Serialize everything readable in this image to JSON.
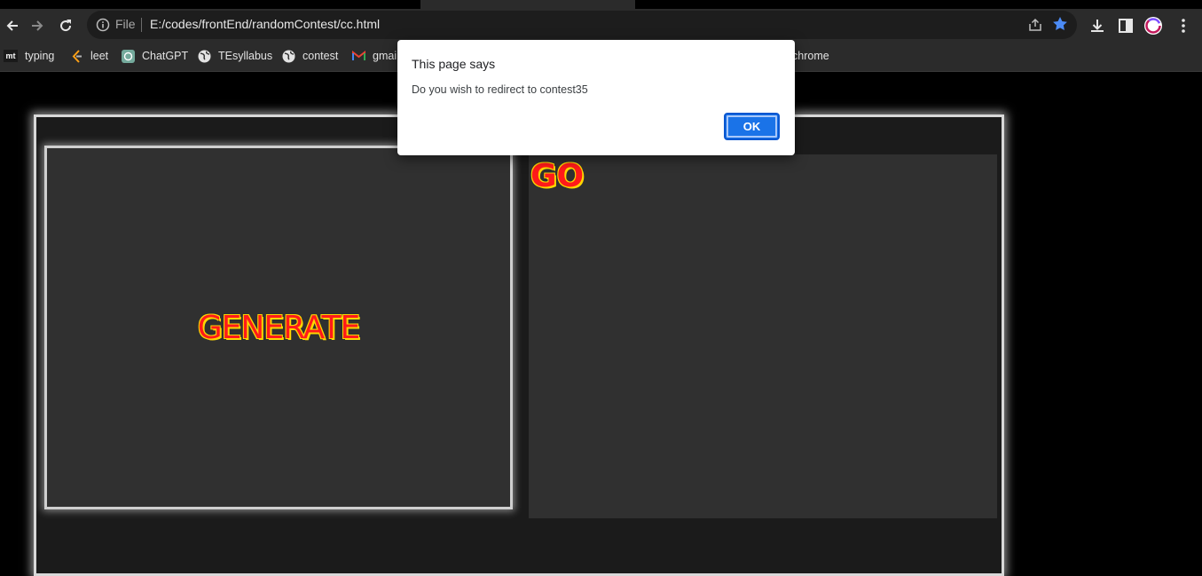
{
  "browser": {
    "url_scheme_label": "File",
    "url": "E:/codes/frontEnd/randomContest/cc.html",
    "bookmarks": [
      {
        "label": "typing",
        "icon": "mt"
      },
      {
        "label": "leet",
        "icon": "leetcode-icon"
      },
      {
        "label": "ChatGPT",
        "icon": "chatgpt-icon"
      },
      {
        "label": "TEsyllabus",
        "icon": "globe-icon"
      },
      {
        "label": "contest",
        "icon": "globe-icon"
      },
      {
        "label": "gmai",
        "icon": "gmail-icon"
      },
      {
        "label": "chrome",
        "icon": ""
      }
    ],
    "colors": {
      "star": "#4c8bf5",
      "toolbar": "#2b2b2b"
    }
  },
  "page": {
    "generate_label": "GENERATE",
    "go_label": "GO",
    "colors": {
      "text_fill": "#ff1a1a",
      "text_outline": "#ffd700",
      "panel": "#303030"
    }
  },
  "dialog": {
    "title": "This page says",
    "message": "Do you wish to redirect to contest35",
    "ok_label": "OK",
    "colors": {
      "button": "#1a73e8"
    }
  }
}
